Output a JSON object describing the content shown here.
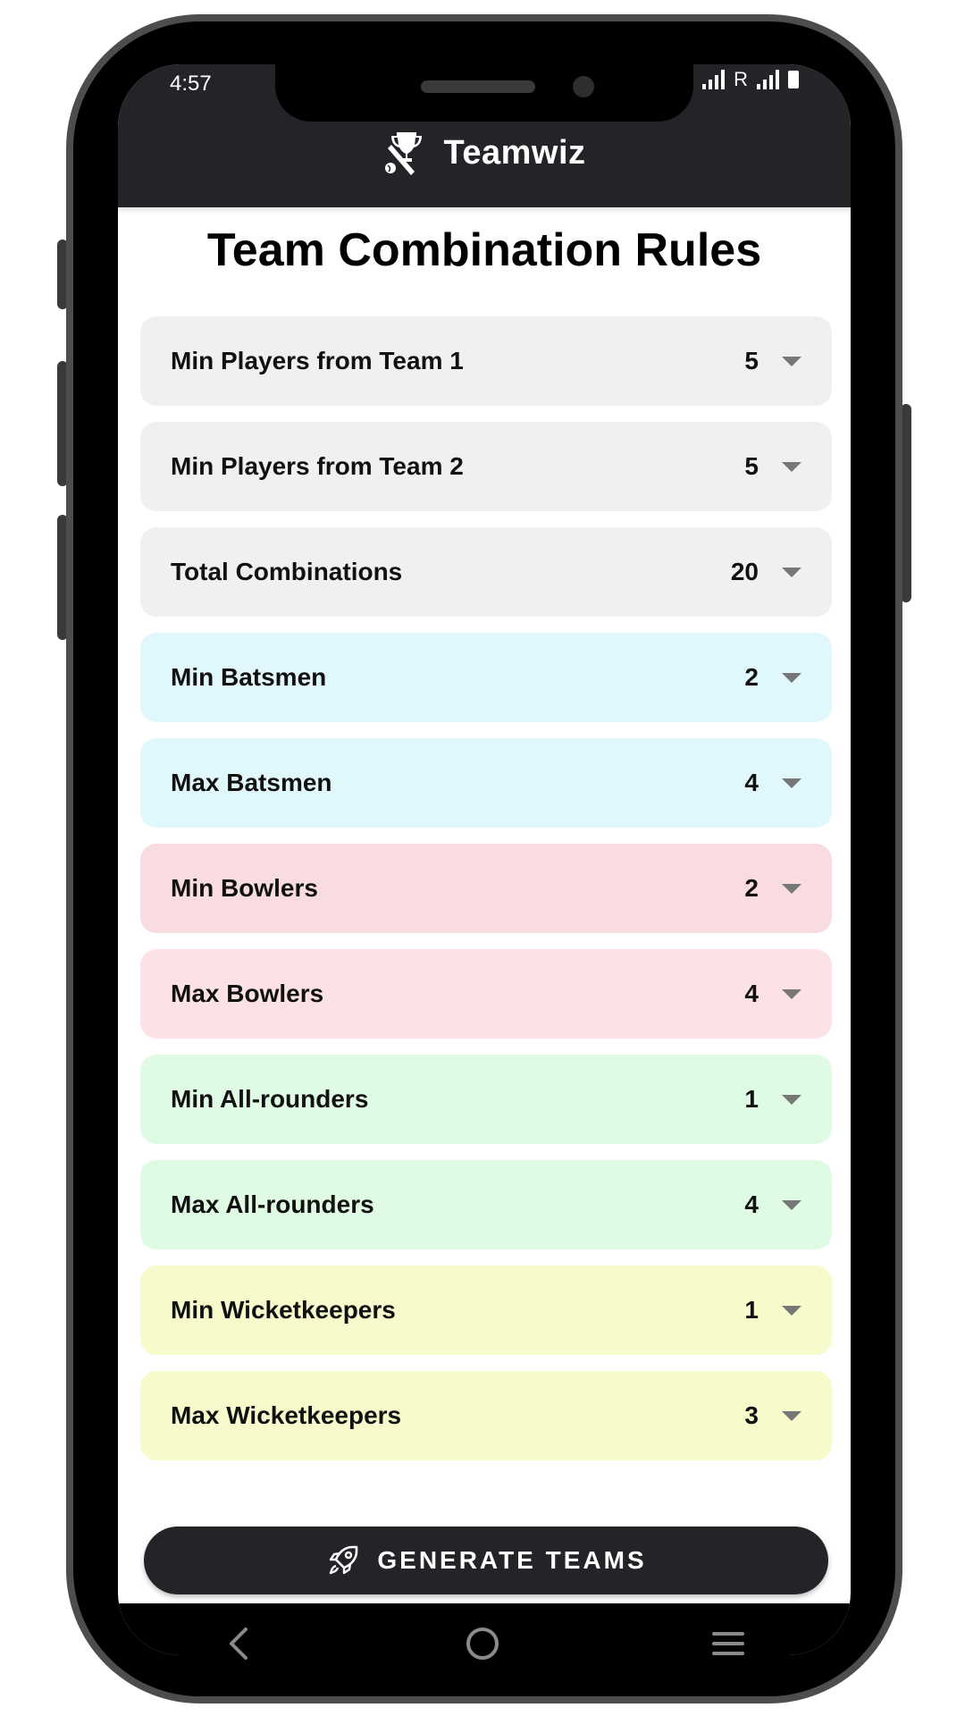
{
  "status": {
    "time": "4:57",
    "carrier": "R"
  },
  "app": {
    "name": "Teamwiz"
  },
  "page": {
    "title": "Team Combination Rules"
  },
  "rules": [
    {
      "label": "Min Players from Team 1",
      "value": "5",
      "bg": "#f0f0f0"
    },
    {
      "label": "Min Players from Team 2",
      "value": "5",
      "bg": "#f0f0f0"
    },
    {
      "label": "Total Combinations",
      "value": "20",
      "bg": "#f0f0f0"
    },
    {
      "label": "Min Batsmen",
      "value": "2",
      "bg": "#e0f7fb"
    },
    {
      "label": "Max Batsmen",
      "value": "4",
      "bg": "#e0f7fb"
    },
    {
      "label": "Min Bowlers",
      "value": "2",
      "bg": "#f8dcdf"
    },
    {
      "label": "Max Bowlers",
      "value": "4",
      "bg": "#fce2e4"
    },
    {
      "label": "Min All-rounders",
      "value": "1",
      "bg": "#dffbe3"
    },
    {
      "label": "Max All-rounders",
      "value": "4",
      "bg": "#dffbe3"
    },
    {
      "label": "Min Wicketkeepers",
      "value": "1",
      "bg": "#f7fbcb"
    },
    {
      "label": "Max Wicketkeepers",
      "value": "3",
      "bg": "#f7fbcb"
    }
  ],
  "actions": {
    "generate_label": "GENERATE TEAMS"
  },
  "colors": {
    "header_bg": "#232427",
    "button_bg": "#232427"
  },
  "icons": {
    "logo": "trophy-cricket-icon",
    "generate": "rocket-icon",
    "nav": [
      "back-icon",
      "home-icon",
      "menu-icon"
    ]
  }
}
